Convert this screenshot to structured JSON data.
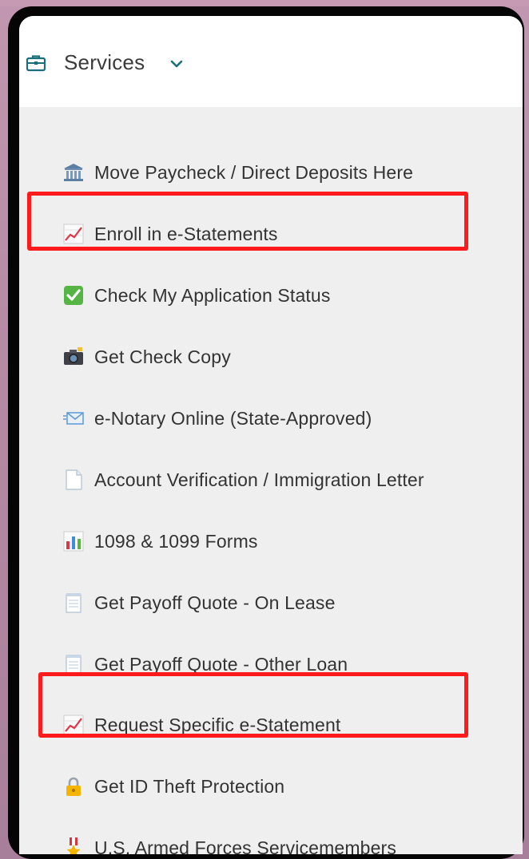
{
  "header": {
    "title": "Services",
    "icon": "briefcase-icon",
    "chevron": "chevron-down-icon",
    "accent": "#1a6f7a"
  },
  "menu": {
    "items": [
      {
        "label": "Move Paycheck / Direct Deposits Here",
        "icon": "bank-icon"
      },
      {
        "label": "Enroll in e-Statements",
        "icon": "chart-up-icon",
        "highlighted": true
      },
      {
        "label": "Check My Application Status",
        "icon": "checkmark-icon"
      },
      {
        "label": "Get Check Copy",
        "icon": "camera-icon"
      },
      {
        "label": "e-Notary Online (State-Approved)",
        "icon": "envelope-icon"
      },
      {
        "label": "Account Verification / Immigration Letter",
        "icon": "document-icon"
      },
      {
        "label": "1098 & 1099 Forms",
        "icon": "bar-chart-icon"
      },
      {
        "label": "Get Payoff Quote - On Lease",
        "icon": "notepad-icon"
      },
      {
        "label": "Get Payoff Quote - Other Loan",
        "icon": "notepad-icon"
      },
      {
        "label": "Request Specific e-Statement",
        "icon": "chart-up-icon",
        "highlighted": true
      },
      {
        "label": "Get ID Theft Protection",
        "icon": "lock-icon"
      },
      {
        "label": "U.S. Armed Forces Servicemembers",
        "icon": "medal-icon"
      }
    ]
  },
  "colors": {
    "highlight_border": "#ff1b1b",
    "menu_background": "#efefef",
    "text": "#333333"
  }
}
